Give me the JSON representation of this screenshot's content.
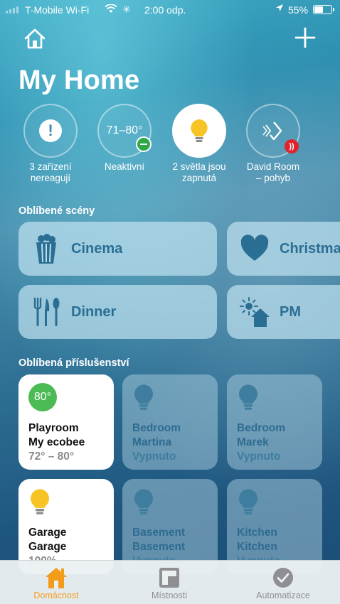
{
  "status_bar": {
    "carrier": "T-Mobile Wi-Fi",
    "time": "2:00 odp.",
    "battery_percent": "55%",
    "battery_level": 0.55
  },
  "header": {
    "title": "My Home",
    "home_icon": "house-icon",
    "add_icon": "plus-icon"
  },
  "status": [
    {
      "label_line1": "3 zařízení",
      "label_line2": "nereagují",
      "icon": "exclamation-icon"
    },
    {
      "value": "71–80°",
      "label_line1": "Neaktivní",
      "label_line2": "",
      "icon": "thermostat-off-badge"
    },
    {
      "label_line1": "2 světla jsou",
      "label_line2": "zapnutá",
      "icon": "lightbulb-icon"
    },
    {
      "label_line1": "David Room",
      "label_line2": "– pohyb",
      "icon": "motion-sensor-icon"
    }
  ],
  "scenes_section": {
    "title": "Oblíbené scény",
    "scenes": [
      {
        "label": "Cinema",
        "icon": "popcorn-icon"
      },
      {
        "label": "Christmas",
        "icon": "heart-icon"
      },
      {
        "label": "Dinner",
        "icon": "cutlery-icon"
      },
      {
        "label": "PM",
        "icon": "sun-house-icon"
      }
    ]
  },
  "accessories_section": {
    "title": "Oblíbená příslušenství",
    "items": [
      {
        "badge": "80°",
        "line1": "Playroom",
        "line2": "My ecobee",
        "state": "72° – 80°",
        "on": true,
        "icon": "thermostat-icon"
      },
      {
        "line1": "Bedroom",
        "line2": "Martina",
        "state": "Vypnuto",
        "on": false,
        "icon": "lightbulb-icon"
      },
      {
        "line1": "Bedroom",
        "line2": "Marek",
        "state": "Vypnuto",
        "on": false,
        "icon": "lightbulb-icon"
      },
      {
        "line1": "Garage",
        "line2": "Garage",
        "state": "100%",
        "on": true,
        "icon": "lightbulb-icon"
      },
      {
        "line1": "Basement",
        "line2": "Basement",
        "state": "Vypnuto",
        "on": false,
        "icon": "lightbulb-icon"
      },
      {
        "line1": "Kitchen",
        "line2": "Kitchen",
        "state": "Vypnuto",
        "on": false,
        "icon": "lightbulb-icon"
      }
    ]
  },
  "tabs": [
    {
      "label": "Domácnost",
      "active": true,
      "icon": "house-icon"
    },
    {
      "label": "Místnosti",
      "active": false,
      "icon": "rooms-icon"
    },
    {
      "label": "Automatizace",
      "active": false,
      "icon": "checkmark-circle-icon"
    }
  ],
  "colors": {
    "accent_orange": "#f39c1a",
    "tile_text_blue": "#2b6e93",
    "bulb_yellow": "#f7c325",
    "thermostat_green": "#4cbb55",
    "alert_red": "#e0242f"
  }
}
